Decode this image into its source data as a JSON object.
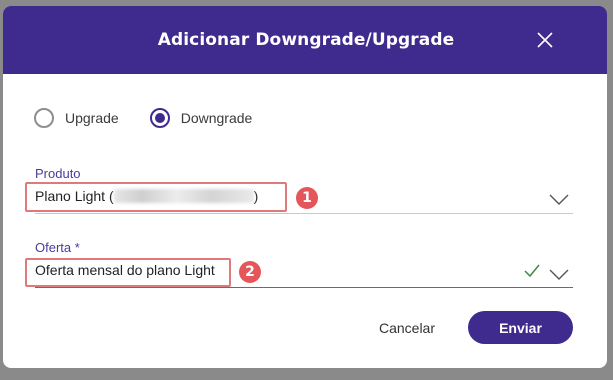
{
  "dialog": {
    "title": "Adicionar Downgrade/Upgrade",
    "close_icon": "close-icon"
  },
  "type_options": [
    {
      "label": "Upgrade",
      "selected": false
    },
    {
      "label": "Downgrade",
      "selected": true
    }
  ],
  "produto": {
    "label": "Produto",
    "value_prefix": "Plano Light (",
    "value_suffix": ")",
    "annotation_badge": "1"
  },
  "oferta": {
    "label": "Oferta *",
    "value": "Oferta mensal do plano Light",
    "annotation_badge": "2",
    "valid": true
  },
  "actions": {
    "cancel_label": "Cancelar",
    "submit_label": "Enviar"
  },
  "colors": {
    "primary": "#3f2a8d",
    "annotation": "#e4565a",
    "valid": "#3d8b40"
  }
}
